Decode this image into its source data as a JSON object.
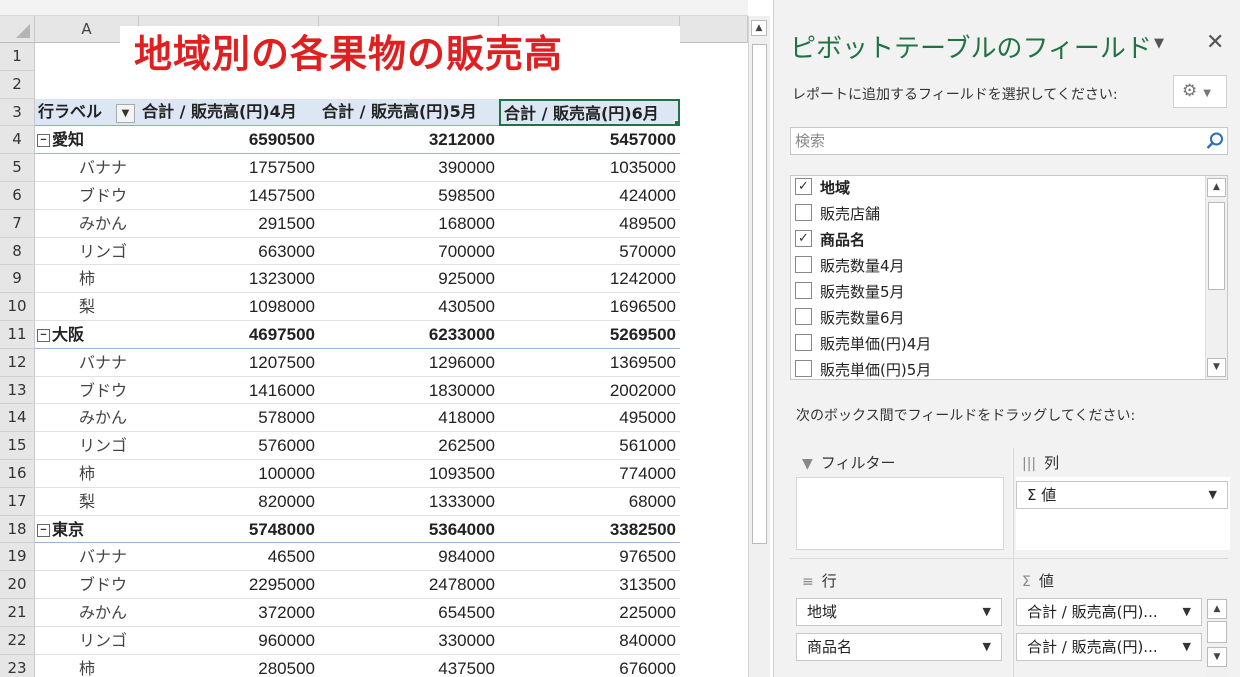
{
  "sheet": {
    "title": "地域別の各果物の販売高",
    "col_a": "A",
    "header": {
      "row_label": "行ラベル",
      "col1": "合計 / 販売高(円)4月",
      "col2": "合計 / 販売高(円)5月",
      "col3": "合計 / 販売高(円)6月"
    },
    "row_numbers": [
      "1",
      "2",
      "3",
      "4",
      "5",
      "6",
      "7",
      "8",
      "9",
      "10",
      "11",
      "12",
      "13",
      "14",
      "15",
      "16",
      "17",
      "18",
      "19",
      "20",
      "21",
      "22",
      "23"
    ],
    "rows": [
      {
        "label": "愛知",
        "v1": "6590500",
        "v2": "3212000",
        "v3": "5457000",
        "group": true
      },
      {
        "label": "バナナ",
        "v1": "1757500",
        "v2": "390000",
        "v3": "1035000"
      },
      {
        "label": "ブドウ",
        "v1": "1457500",
        "v2": "598500",
        "v3": "424000"
      },
      {
        "label": "みかん",
        "v1": "291500",
        "v2": "168000",
        "v3": "489500"
      },
      {
        "label": "リンゴ",
        "v1": "663000",
        "v2": "700000",
        "v3": "570000"
      },
      {
        "label": "柿",
        "v1": "1323000",
        "v2": "925000",
        "v3": "1242000"
      },
      {
        "label": "梨",
        "v1": "1098000",
        "v2": "430500",
        "v3": "1696500"
      },
      {
        "label": "大阪",
        "v1": "4697500",
        "v2": "6233000",
        "v3": "5269500",
        "group": true
      },
      {
        "label": "バナナ",
        "v1": "1207500",
        "v2": "1296000",
        "v3": "1369500"
      },
      {
        "label": "ブドウ",
        "v1": "1416000",
        "v2": "1830000",
        "v3": "2002000"
      },
      {
        "label": "みかん",
        "v1": "578000",
        "v2": "418000",
        "v3": "495000"
      },
      {
        "label": "リンゴ",
        "v1": "576000",
        "v2": "262500",
        "v3": "561000"
      },
      {
        "label": "柿",
        "v1": "100000",
        "v2": "1093500",
        "v3": "774000"
      },
      {
        "label": "梨",
        "v1": "820000",
        "v2": "1333000",
        "v3": "68000"
      },
      {
        "label": "東京",
        "v1": "5748000",
        "v2": "5364000",
        "v3": "3382500",
        "group": true
      },
      {
        "label": "バナナ",
        "v1": "46500",
        "v2": "984000",
        "v3": "976500"
      },
      {
        "label": "ブドウ",
        "v1": "2295000",
        "v2": "2478000",
        "v3": "313500"
      },
      {
        "label": "みかん",
        "v1": "372000",
        "v2": "654500",
        "v3": "225000"
      },
      {
        "label": "リンゴ",
        "v1": "960000",
        "v2": "330000",
        "v3": "840000"
      },
      {
        "label": "柿",
        "v1": "280500",
        "v2": "437500",
        "v3": "676000"
      }
    ]
  },
  "panel": {
    "title": "ピボットテーブルのフィールド",
    "subtitle": "レポートに追加するフィールドを選択してください:",
    "search_placeholder": "検索",
    "fields": [
      {
        "label": "地域",
        "checked": true
      },
      {
        "label": "販売店舗",
        "checked": false
      },
      {
        "label": "商品名",
        "checked": true
      },
      {
        "label": "販売数量4月",
        "checked": false
      },
      {
        "label": "販売数量5月",
        "checked": false
      },
      {
        "label": "販売数量6月",
        "checked": false
      },
      {
        "label": "販売単価(円)4月",
        "checked": false
      },
      {
        "label": "販売単価(円)5月",
        "checked": false
      }
    ],
    "drag_hint": "次のボックス間でフィールドをドラッグしてください:",
    "areas": {
      "filter": "フィルター",
      "columns": "列",
      "rows": "行",
      "values": "値"
    },
    "column_chips": [
      "Σ 値"
    ],
    "row_chips": [
      "地域",
      "商品名"
    ],
    "value_chips": [
      "合計 / 販売高(円)...",
      "合計 / 販売高(円)..."
    ]
  },
  "colors": {
    "accent": "#217346",
    "title_red": "#e02020",
    "header_fill": "#dde6f3"
  }
}
